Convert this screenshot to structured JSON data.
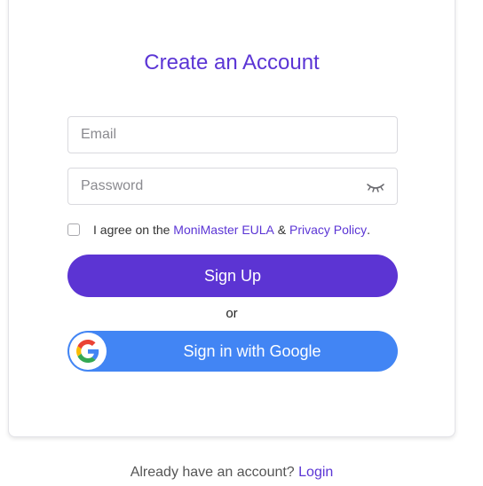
{
  "title": "Create an Account",
  "email": {
    "placeholder": "Email",
    "value": ""
  },
  "password": {
    "placeholder": "Password",
    "value": "",
    "toggle_icon": "eye-closed-icon"
  },
  "agreement": {
    "prefix": "I agree on the ",
    "eula_link": "MoniMaster EULA",
    "connector": " & ",
    "privacy_link": "Privacy Policy",
    "suffix": ".",
    "checked": false
  },
  "signup_label": "Sign Up",
  "or_text": "or",
  "google": {
    "label": "Sign in with Google",
    "icon": "google-g-icon"
  },
  "footer": {
    "text": "Already have an account? ",
    "login_link": "Login"
  },
  "colors": {
    "accent": "#5c34d3",
    "google_blue": "#4285f4",
    "link": "#5b35d5"
  }
}
